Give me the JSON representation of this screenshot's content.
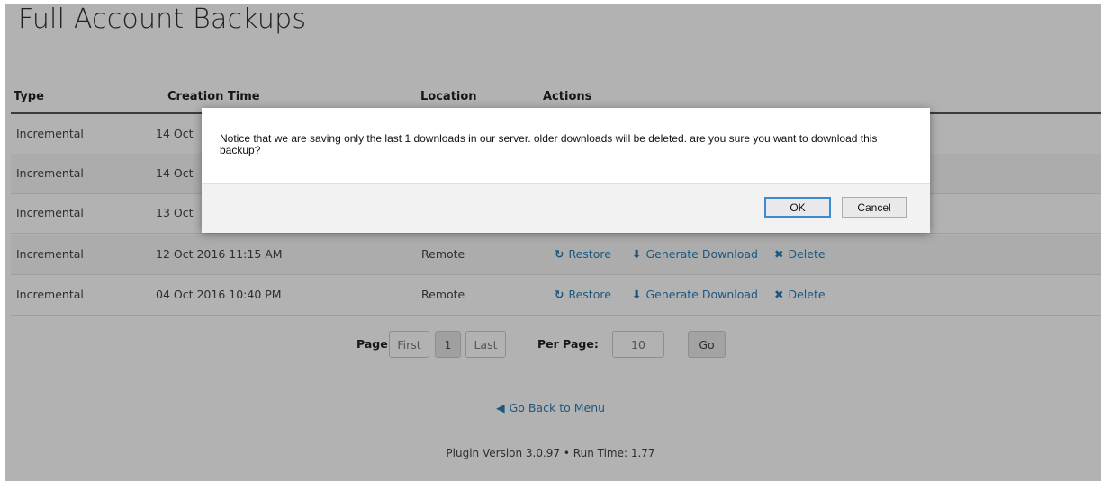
{
  "page": {
    "title": "Full Account Backups"
  },
  "table": {
    "headers": [
      "Type",
      "Creation Time",
      "Location",
      "Actions"
    ],
    "rows": [
      {
        "type": "Incremental",
        "time": "14 Oct",
        "location": "",
        "hidden_by_dialog": true
      },
      {
        "type": "Incremental",
        "time": "14 Oct",
        "location": "",
        "hidden_by_dialog": true
      },
      {
        "type": "Incremental",
        "time": "13 Oct",
        "location": "",
        "hidden_by_dialog": true
      },
      {
        "type": "Incremental",
        "time": "12 Oct 2016 11:15 AM",
        "location": "Remote"
      },
      {
        "type": "Incremental",
        "time": "04 Oct 2016 10:40 PM",
        "location": "Remote"
      }
    ],
    "actions": {
      "restore": "Restore",
      "generate_download": "Generate Download",
      "delete": "Delete"
    }
  },
  "pagination": {
    "page_label": "Page:",
    "first": "First",
    "current": "1",
    "last": "Last",
    "per_page_label": "Per Page:",
    "per_page_value": "10",
    "go": "Go"
  },
  "nav": {
    "back": "Go Back to Menu"
  },
  "footer": {
    "text": "Plugin Version 3.0.97 • Run Time: 1.77"
  },
  "dialog": {
    "message": "Notice that we are saving only the last 1 downloads in our server. older downloads will be deleted. are you sure you want to download this backup?",
    "ok": "OK",
    "cancel": "Cancel"
  },
  "icons": {
    "restore": "refresh-icon",
    "download": "download-circle-icon",
    "delete": "close-x-icon",
    "back": "arrow-left-circle-icon"
  },
  "colors": {
    "link": "#2a7fb8",
    "overlay": "rgba(0,0,0,0.30)",
    "ok_border": "#3a8ad6"
  }
}
